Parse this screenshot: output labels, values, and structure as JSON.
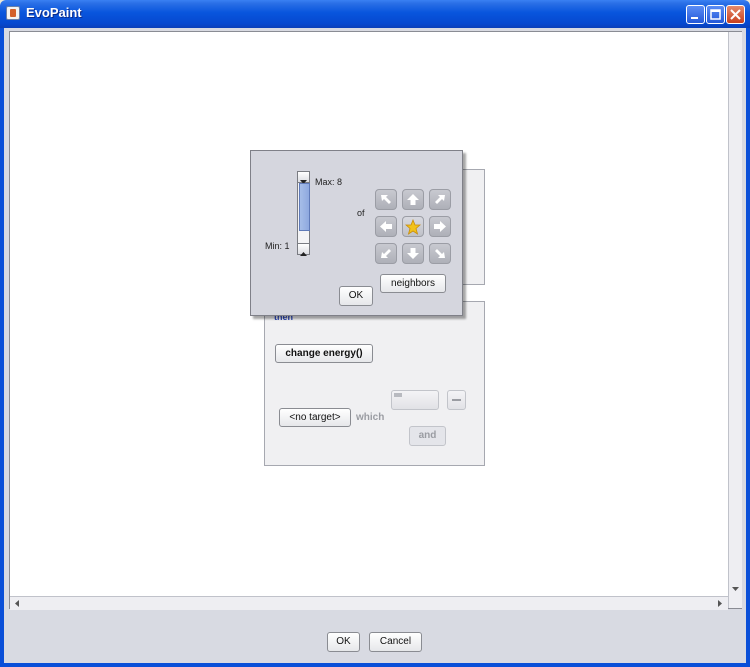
{
  "window": {
    "title": "EvoPaint"
  },
  "popup": {
    "max_label": "Max: 8",
    "min_label": "Min: 1",
    "of_label": "of",
    "neighbors_button": "neighbors",
    "ok_button": "OK",
    "direction_icons": [
      "arrow-up-left-icon",
      "arrow-up-icon",
      "arrow-up-right-icon",
      "arrow-left-icon",
      "star-icon",
      "arrow-right-icon",
      "arrow-down-left-icon",
      "arrow-down-icon",
      "arrow-down-right-icon"
    ]
  },
  "then_panel": {
    "label": "then",
    "action_button": "change energy()",
    "target_button": "<no target>",
    "which_label": "which",
    "and_button": "and"
  },
  "footer": {
    "ok_button": "OK",
    "cancel_button": "Cancel"
  },
  "colors": {
    "title_bar": "#0855dd",
    "then_label": "#2b46b8",
    "star": "#f2c21a"
  }
}
